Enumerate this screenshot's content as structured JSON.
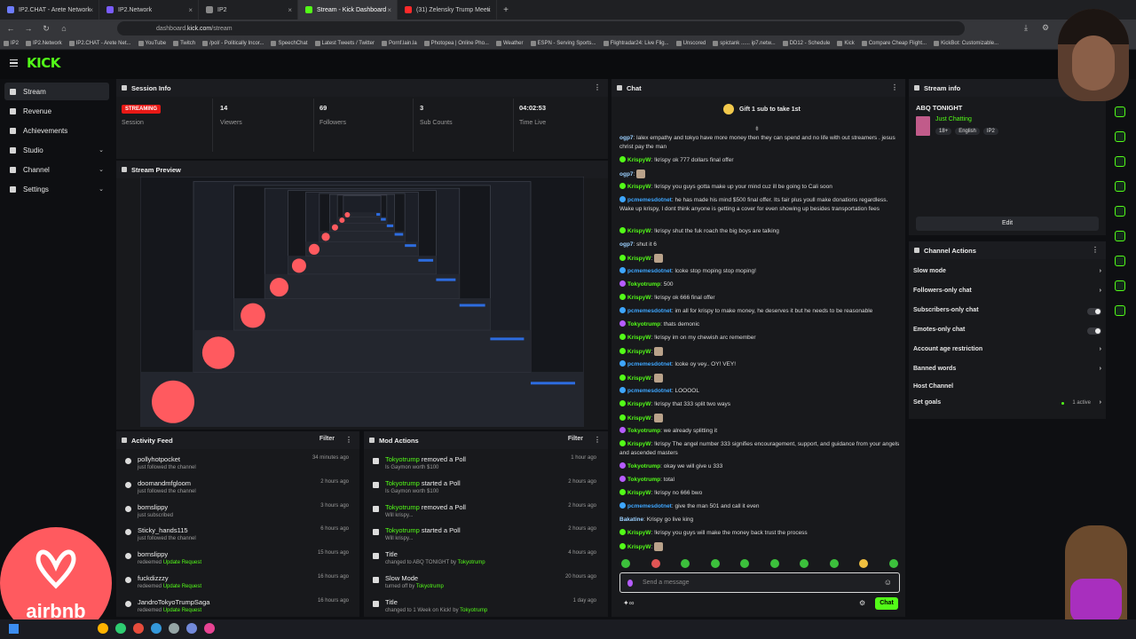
{
  "browser": {
    "tabs": [
      {
        "title": "IP2.CHAT - Arete Network",
        "fav_color": "#6d7cff"
      },
      {
        "title": "IP2.Network",
        "fav_color": "#7a5cff"
      },
      {
        "title": "IP2",
        "fav_color": "#888888"
      },
      {
        "title": "Stream - Kick Dashboard",
        "fav_color": "#53fc18"
      },
      {
        "title": "(31) Zelensky Trump Meeti",
        "fav_color": "#ff2a2a"
      }
    ],
    "new_tab": "+",
    "url_prefix": "dashboard.",
    "url_domain": "kick.com",
    "url_path": "/stream",
    "bookmarks": [
      "IP2",
      "IP2.Network",
      "IP2.CHAT - Arete Net...",
      "YouTube",
      "Twitch",
      "/pol/ - Politically Incor...",
      "SpeechChat",
      "Latest Tweets / Twitter",
      "Pornf.lain.la",
      "Photopea | Online Pho...",
      "Weather",
      "ESPN - Serving Sports...",
      "Flightradar24: Live Flig...",
      "Unscored",
      "spictank ...... ip7.netw...",
      "DD12 - Schedule",
      "Kick",
      "Compare Cheap Flight...",
      "KickBot: Customizable..."
    ]
  },
  "header": {
    "logo": "KICK"
  },
  "sidebar": {
    "items": [
      {
        "label": "Stream",
        "active": true,
        "chevron": false
      },
      {
        "label": "Revenue",
        "chevron": false
      },
      {
        "label": "Achievements",
        "chevron": false
      },
      {
        "label": "Studio",
        "chevron": true
      },
      {
        "label": "Channel",
        "chevron": true
      },
      {
        "label": "Settings",
        "chevron": true
      }
    ],
    "chevron_glyph": "⌄"
  },
  "session": {
    "title": "Session Info",
    "badge": "STREAMING",
    "session_label": "Session",
    "stats": [
      {
        "value": "14",
        "label": "Viewers"
      },
      {
        "value": "69",
        "label": "Followers"
      },
      {
        "value": "3",
        "label": "Sub Counts"
      },
      {
        "value": "04:02:53",
        "label": "Time Live"
      }
    ]
  },
  "preview": {
    "title": "Stream Preview"
  },
  "overlay": {
    "logo_text": "airbnb"
  },
  "activity": {
    "title": "Activity Feed",
    "filter": "Filter",
    "rows": [
      {
        "name": "pollyhotpocket",
        "sub": "just followed the channel",
        "sub_hl": "",
        "time": "34 minutes ago"
      },
      {
        "name": "doomandmfgloom",
        "sub": "just followed the channel",
        "sub_hl": "",
        "time": "2 hours ago"
      },
      {
        "name": "bornslippy",
        "sub": "just subscribed",
        "sub_hl": "",
        "time": "3 hours ago"
      },
      {
        "name": "Sticky_hands115",
        "sub": "just followed the channel",
        "sub_hl": "",
        "time": "6 hours ago"
      },
      {
        "name": "bornslippy",
        "sub": "redeemed ",
        "sub_hl": "Update Request",
        "time": "15 hours ago"
      },
      {
        "name": "fuckdizzzy",
        "sub": "redeemed ",
        "sub_hl": "Update Request",
        "time": "16 hours ago"
      },
      {
        "name": "JandroTokyoTrumpSaga",
        "sub": "redeemed ",
        "sub_hl": "Update Request",
        "time": "16 hours ago"
      }
    ]
  },
  "mod": {
    "title": "Mod Actions",
    "filter": "Filter",
    "rows": [
      {
        "user": "Tokyotrump",
        "action": " removed a Poll",
        "sub": "Is Gaymon worth $100",
        "sub_hl": "",
        "time": "1 hour ago"
      },
      {
        "user": "Tokyotrump",
        "action": " started a Poll",
        "sub": "Is Gaymon worth $100",
        "sub_hl": "",
        "time": "2 hours ago"
      },
      {
        "user": "Tokyotrump",
        "action": " removed a Poll",
        "sub": "Will krispy...",
        "sub_hl": "",
        "time": "2 hours ago"
      },
      {
        "user": "Tokyotrump",
        "action": " started a Poll",
        "sub": "Will krispy...",
        "sub_hl": "",
        "time": "2 hours ago"
      },
      {
        "user": "",
        "action": "Title",
        "sub": "changed to ABQ TONIGHT by ",
        "sub_hl": "Tokyotrump",
        "time": "4 hours ago"
      },
      {
        "user": "",
        "action": "Slow Mode",
        "sub": "turned off by ",
        "sub_hl": "Tokyotrump",
        "time": "20 hours ago"
      },
      {
        "user": "",
        "action": "Title",
        "sub": "changed to 1 Week on Kick! by ",
        "sub_hl": "Tokyotrump",
        "time": "1 day ago"
      }
    ]
  },
  "chat": {
    "title": "Chat",
    "gift": "Gift 1 sub to take 1st",
    "input_placeholder": "Send a message",
    "send_label": "Chat",
    "messages": [
      {
        "user": "ogp7",
        "color": "#9bd0ff",
        "badge": "",
        "text": "lalex empathy and tokyo have more money then they can spend and no life with out streamers . jesus christ pay the man",
        "lines": 2
      },
      {
        "user": "KrispyW",
        "color": "#53fc18",
        "badge": "#53fc18",
        "text": "!krispy ok 777 dollars final offer",
        "lines": 1
      },
      {
        "user": "ogp7",
        "color": "#9bd0ff",
        "badge": "",
        "text": "",
        "lines": 1,
        "emote": true
      },
      {
        "user": "KrispyW",
        "color": "#53fc18",
        "badge": "#53fc18",
        "text": "!krispy you guys gotta make up your mind cuz ill be going to Cali soon",
        "lines": 1
      },
      {
        "user": "pcmemesdotnet",
        "color": "#3ea6ff",
        "badge": "#3ea6ff",
        "text": "he has made his mind $500 final offer. Its fair plus youll make donations regardless. Wake up krispy, I dont think anyone is getting a cover for even showing up besides transportation fees",
        "lines": 3
      },
      {
        "user": "KrispyW",
        "color": "#53fc18",
        "badge": "#53fc18",
        "text": "!krispy shut the fuk roach the big boys are talking",
        "lines": 1
      },
      {
        "user": "ogp7",
        "color": "#9bd0ff",
        "badge": "",
        "text": "shut it 6",
        "lines": 1
      },
      {
        "user": "KrispyW",
        "color": "#53fc18",
        "badge": "#53fc18",
        "text": "",
        "lines": 1,
        "emote": true
      },
      {
        "user": "pcmemesdotnet",
        "color": "#3ea6ff",
        "badge": "#3ea6ff",
        "text": "lcoke stop moping stop moping!",
        "lines": 1
      },
      {
        "user": "Tokyotrump",
        "color": "#53fc18",
        "badge": "#b65cff",
        "text": "500",
        "lines": 1
      },
      {
        "user": "KrispyW",
        "color": "#53fc18",
        "badge": "#53fc18",
        "text": "!krispy ok 666 final offer",
        "lines": 1
      },
      {
        "user": "pcmemesdotnet",
        "color": "#3ea6ff",
        "badge": "#3ea6ff",
        "text": "im all for krispy to make money, he deserves it but he needs to be reasonable",
        "lines": 1
      },
      {
        "user": "Tokyotrump",
        "color": "#53fc18",
        "badge": "#b65cff",
        "text": "thats demonic",
        "lines": 1
      },
      {
        "user": "KrispyW",
        "color": "#53fc18",
        "badge": "#53fc18",
        "text": "!krispy im on my chewish arc remember",
        "lines": 1
      },
      {
        "user": "KrispyW",
        "color": "#53fc18",
        "badge": "#53fc18",
        "text": "",
        "lines": 1,
        "emote": true
      },
      {
        "user": "pcmemesdotnet",
        "color": "#3ea6ff",
        "badge": "#3ea6ff",
        "text": "lcoke oy vey.. OY! VEY!",
        "lines": 1
      },
      {
        "user": "KrispyW",
        "color": "#53fc18",
        "badge": "#53fc18",
        "text": "",
        "lines": 1,
        "emote": true
      },
      {
        "user": "pcmemesdotnet",
        "color": "#3ea6ff",
        "badge": "#3ea6ff",
        "text": "LOOOOL",
        "lines": 1
      },
      {
        "user": "KrispyW",
        "color": "#53fc18",
        "badge": "#53fc18",
        "text": "!krispy that 333 split two ways",
        "lines": 1
      },
      {
        "user": "KrispyW",
        "color": "#53fc18",
        "badge": "#53fc18",
        "text": "",
        "lines": 1,
        "emote": true
      },
      {
        "user": "Tokyotrump",
        "color": "#53fc18",
        "badge": "#b65cff",
        "text": "we already splitting it",
        "lines": 1
      },
      {
        "user": "KrispyW",
        "color": "#53fc18",
        "badge": "#53fc18",
        "text": "!krispy The angel number 333 signifies encouragement, support, and guidance from your angels and ascended masters",
        "lines": 2
      },
      {
        "user": "Tokyotrump",
        "color": "#53fc18",
        "badge": "#b65cff",
        "text": "okay we will give u 333",
        "lines": 1
      },
      {
        "user": "Tokyotrump",
        "color": "#53fc18",
        "badge": "#b65cff",
        "text": "total",
        "lines": 1
      },
      {
        "user": "KrispyW",
        "color": "#53fc18",
        "badge": "#53fc18",
        "text": "!krispy no 666 bwo",
        "lines": 1
      },
      {
        "user": "pcmemesdotnet",
        "color": "#3ea6ff",
        "badge": "#3ea6ff",
        "text": "give the man 501 and call it even",
        "lines": 1
      },
      {
        "user": "Bakatine",
        "color": "#9bd0ff",
        "badge": "",
        "text": "Krispy go live king",
        "lines": 1
      },
      {
        "user": "KrispyW",
        "color": "#53fc18",
        "badge": "#53fc18",
        "text": "!krispy you guys will make the money back trust the process",
        "lines": 1
      },
      {
        "user": "KrispyW",
        "color": "#53fc18",
        "badge": "#53fc18",
        "text": "",
        "lines": 1,
        "emote": true
      }
    ]
  },
  "stream_info": {
    "title": "Stream info",
    "stream_title": "ABQ TONIGHT",
    "category": "Just Chatting",
    "tags": [
      "18+",
      "English",
      "IP2"
    ],
    "edit": "Edit"
  },
  "channel_actions": {
    "title": "Channel Actions",
    "rows": [
      {
        "label": "Slow mode",
        "kind": "arrow"
      },
      {
        "label": "Followers-only chat",
        "kind": "arrow"
      },
      {
        "label": "Subscribers-only chat",
        "kind": "toggle"
      },
      {
        "label": "Emotes-only chat",
        "kind": "toggle"
      },
      {
        "label": "Account age restriction",
        "kind": "arrow"
      },
      {
        "label": "Banned words",
        "kind": "arrow"
      },
      {
        "label": "Host Channel",
        "kind": "none"
      },
      {
        "label": "Set goals",
        "kind": "arrow",
        "note": "1 active"
      }
    ]
  },
  "colors": {
    "accent": "#53fc18",
    "live": "#e91916",
    "airbnb": "#ff5a5f"
  }
}
